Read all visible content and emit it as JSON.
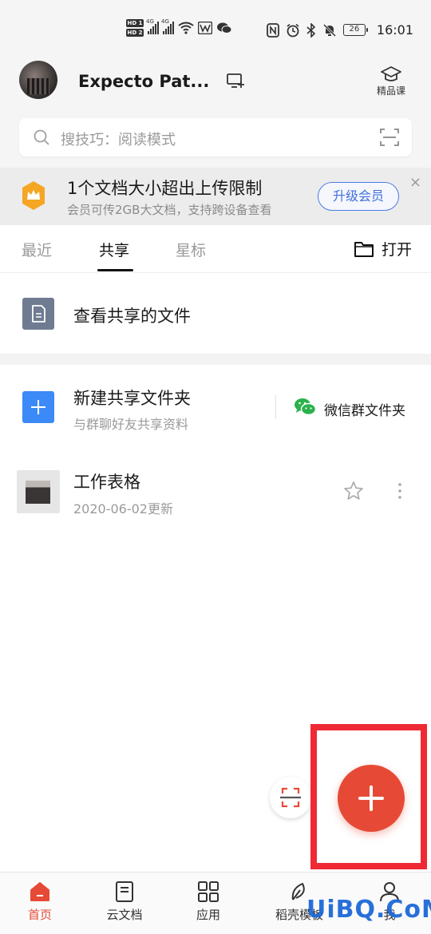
{
  "status_bar": {
    "hd1": "HD 1",
    "hd2": "HD 2",
    "net1": "4G",
    "net2": "4G",
    "battery": "26",
    "time": "16:01"
  },
  "header": {
    "username": "Expecto Pat...",
    "premium_label": "精品课",
    "search_placeholder": "搜技巧：阅读模式"
  },
  "banner": {
    "title": "1个文档大小超出上传限制",
    "subtitle": "会员可传2GB大文档，支持跨设备查看",
    "button": "升级会员",
    "close": "×"
  },
  "tabs": {
    "items": [
      "最近",
      "共享",
      "星标"
    ],
    "active": "共享",
    "open_label": "打开"
  },
  "shared": {
    "view_label": "查看共享的文件"
  },
  "new_folder": {
    "title": "新建共享文件夹",
    "subtitle": "与群聊好友共享资料",
    "wechat_label": "微信群文件夹"
  },
  "files": [
    {
      "name": "工作表格",
      "date": "2020-06-02更新"
    }
  ],
  "bottom_nav": {
    "items": [
      "首页",
      "云文档",
      "应用",
      "稻壳模板",
      "我"
    ],
    "active": "首页"
  },
  "watermark": "UiBQ.CoM",
  "colors": {
    "accent": "#e64a36",
    "blue": "#3b8af7",
    "highlight_frame": "#ef2a34",
    "wechat_green": "#2bb24c"
  }
}
